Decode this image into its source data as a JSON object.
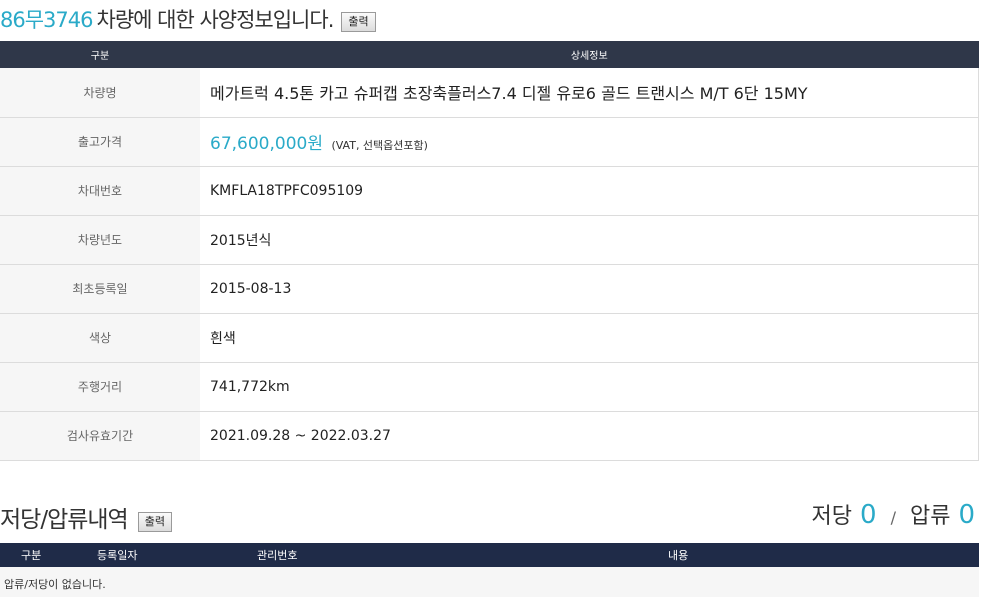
{
  "header": {
    "plate": "86무3746",
    "title_rest": "차량에 대한 사양정보입니다.",
    "print_label": "출력"
  },
  "spec_table": {
    "col_category": "구분",
    "col_detail": "상세정보",
    "rows": [
      {
        "label": "차량명",
        "value": "메가트럭 4.5톤 카고 슈퍼캡 초장축플러스7.4 디젤 유로6 골드 트랜시스 M/T 6단 15MY"
      },
      {
        "label": "출고가격",
        "value": "67,600,000원",
        "note": "(VAT, 선택옵션포함)"
      },
      {
        "label": "차대번호",
        "value": "KMFLA18TPFC095109"
      },
      {
        "label": "차량년도",
        "value": "2015년식"
      },
      {
        "label": "최초등록일",
        "value": "2015-08-13"
      },
      {
        "label": "색상",
        "value": "흰색"
      },
      {
        "label": "주행거리",
        "value": "741,772km"
      },
      {
        "label": "검사유효기간",
        "value": "2021.09.28 ~ 2022.03.27"
      }
    ]
  },
  "lien_section": {
    "title": "저당/압류내역",
    "print_label": "출력",
    "mortgage_label": "저당",
    "mortgage_count": "0",
    "seizure_label": "압류",
    "seizure_count": "0",
    "separator": "/",
    "columns": [
      "구분",
      "등록일자",
      "관리번호",
      "내용"
    ],
    "empty_message": "압류/저당이 없습니다."
  },
  "colors": {
    "accent": "#2aaac8",
    "header_bg": "#2f3749",
    "lien_header_bg": "#1f2b48"
  }
}
